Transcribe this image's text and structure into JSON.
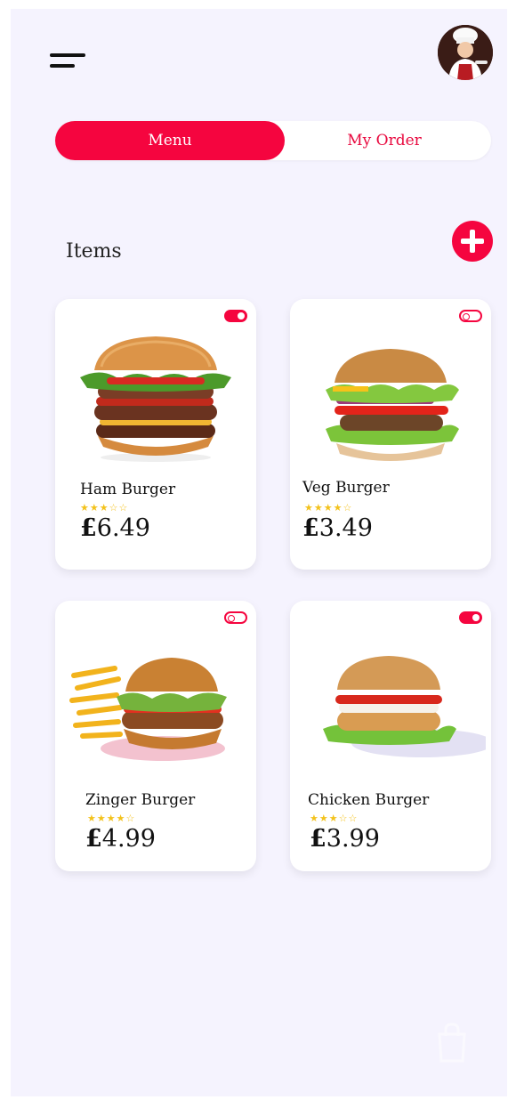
{
  "header": {
    "menu_icon": "hamburger-menu-icon",
    "avatar": "chef-avatar"
  },
  "tabs": [
    {
      "label": "Menu",
      "active": true
    },
    {
      "label": "My Order",
      "active": false
    }
  ],
  "section": {
    "title": "Items",
    "add_icon": "plus-circle-icon"
  },
  "items": [
    {
      "name": "Ham Burger",
      "rating": 3,
      "stars": "★★★☆☆",
      "currency": "£",
      "price": "6.49",
      "available": true
    },
    {
      "name": "Veg Burger",
      "rating": 4,
      "stars": "★★★★☆",
      "currency": "£",
      "price": "3.49",
      "available": false
    },
    {
      "name": "Zinger Burger",
      "rating": 4,
      "stars": "★★★★☆",
      "currency": "£",
      "price": "4.99",
      "available": false
    },
    {
      "name": "Chicken Burger",
      "rating": 3,
      "stars": "★★★☆☆",
      "currency": "£",
      "price": "3.99",
      "available": true
    }
  ],
  "footer": {
    "cart_icon": "shopping-bag-icon"
  },
  "colors": {
    "accent": "#f5053f",
    "background": "#f5f3fe",
    "card": "#ffffff",
    "star": "#f3c21c"
  }
}
